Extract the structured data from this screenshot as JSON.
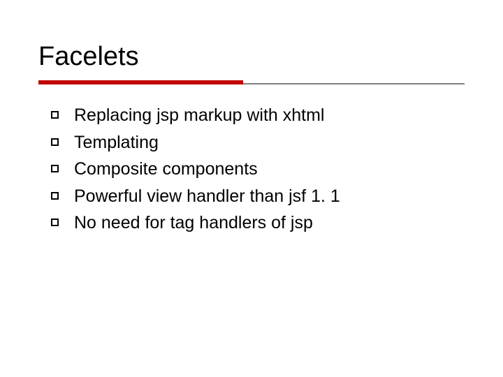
{
  "slide": {
    "title": "Facelets",
    "bullets": [
      "Replacing jsp markup with xhtml",
      "Templating",
      "Composite components",
      "Powerful view handler than jsf 1. 1",
      "No need for tag handlers of jsp"
    ]
  },
  "colors": {
    "accent": "#c00000",
    "text": "#000000",
    "divider": "#808080"
  }
}
